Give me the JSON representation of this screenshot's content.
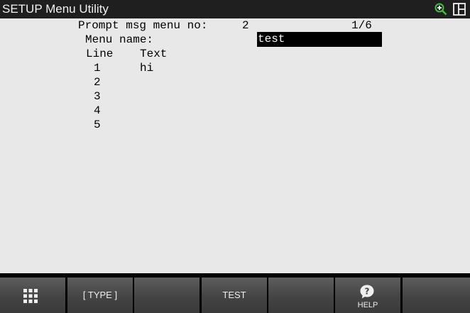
{
  "window": {
    "title": "SETUP Menu Utility",
    "icons": [
      "zoom-in-icon",
      "split-window-icon"
    ]
  },
  "screen": {
    "prompt_label": "Prompt msg menu no:",
    "prompt_number": "2",
    "page_indicator": "1/6",
    "menu_name_label": "Menu name:",
    "menu_name_value": "test",
    "columns": {
      "line": "Line",
      "text": "Text"
    },
    "rows": [
      {
        "line": "1",
        "text": "hi"
      },
      {
        "line": "2",
        "text": ""
      },
      {
        "line": "3",
        "text": ""
      },
      {
        "line": "4",
        "text": ""
      },
      {
        "line": "5",
        "text": ""
      }
    ]
  },
  "function_keys": [
    {
      "label": "",
      "icon": "grid-menu-icon"
    },
    {
      "label": "[ TYPE ]"
    },
    {
      "label": ""
    },
    {
      "label": "TEST"
    },
    {
      "label": ""
    },
    {
      "label": "HELP",
      "icon": "help-icon"
    },
    {
      "label": ""
    }
  ]
}
